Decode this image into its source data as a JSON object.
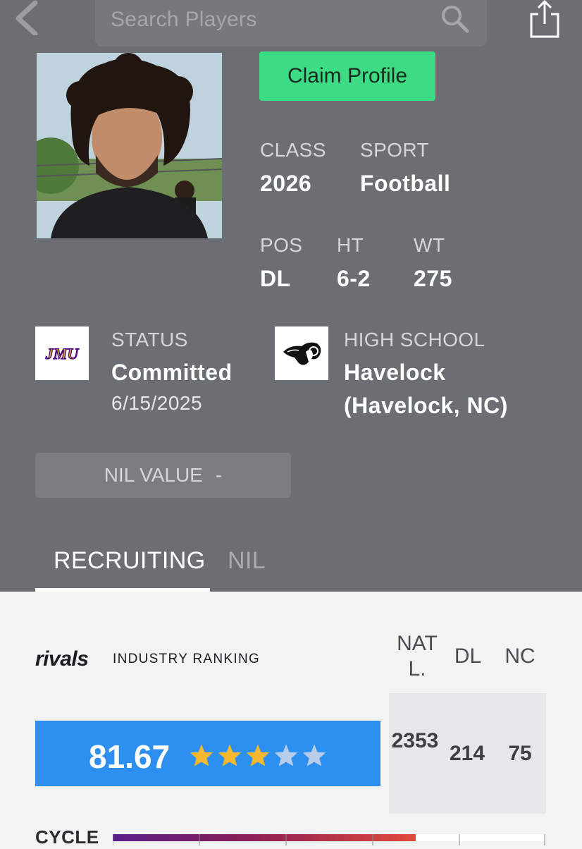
{
  "header": {
    "search_placeholder": "Search Players"
  },
  "profile": {
    "claim_label": "Claim Profile",
    "class_label": "CLASS",
    "class_value": "2026",
    "sport_label": "SPORT",
    "sport_value": "Football",
    "pos_label": "POS",
    "pos_value": "DL",
    "ht_label": "HT",
    "ht_value": "6-2",
    "wt_label": "WT",
    "wt_value": "275"
  },
  "status": {
    "logo_text": "JMU",
    "label": "STATUS",
    "value": "Committed",
    "date": "6/15/2025"
  },
  "school": {
    "label": "HIGH SCHOOL",
    "name": "Havelock",
    "location": "(Havelock, NC)"
  },
  "nil": {
    "label": "NIL VALUE",
    "value": "-"
  },
  "tabs": [
    {
      "label": "RECRUITING",
      "active": true
    },
    {
      "label": "NIL",
      "active": false
    }
  ],
  "ranking": {
    "brand": "rivals",
    "title": "INDUSTRY RANKING",
    "columns": [
      "NAT L.",
      "DL",
      "NC"
    ],
    "score": "81.67",
    "stars_filled": 3,
    "stars_total": 5,
    "nat_rank": "2353",
    "pos_rank": "214",
    "state_rank": "75",
    "colors": {
      "bar": "#2d8ff0",
      "star_on": "#f5b82e",
      "star_off": "#b7cde8"
    }
  },
  "cycle": {
    "label": "CYCLE"
  }
}
